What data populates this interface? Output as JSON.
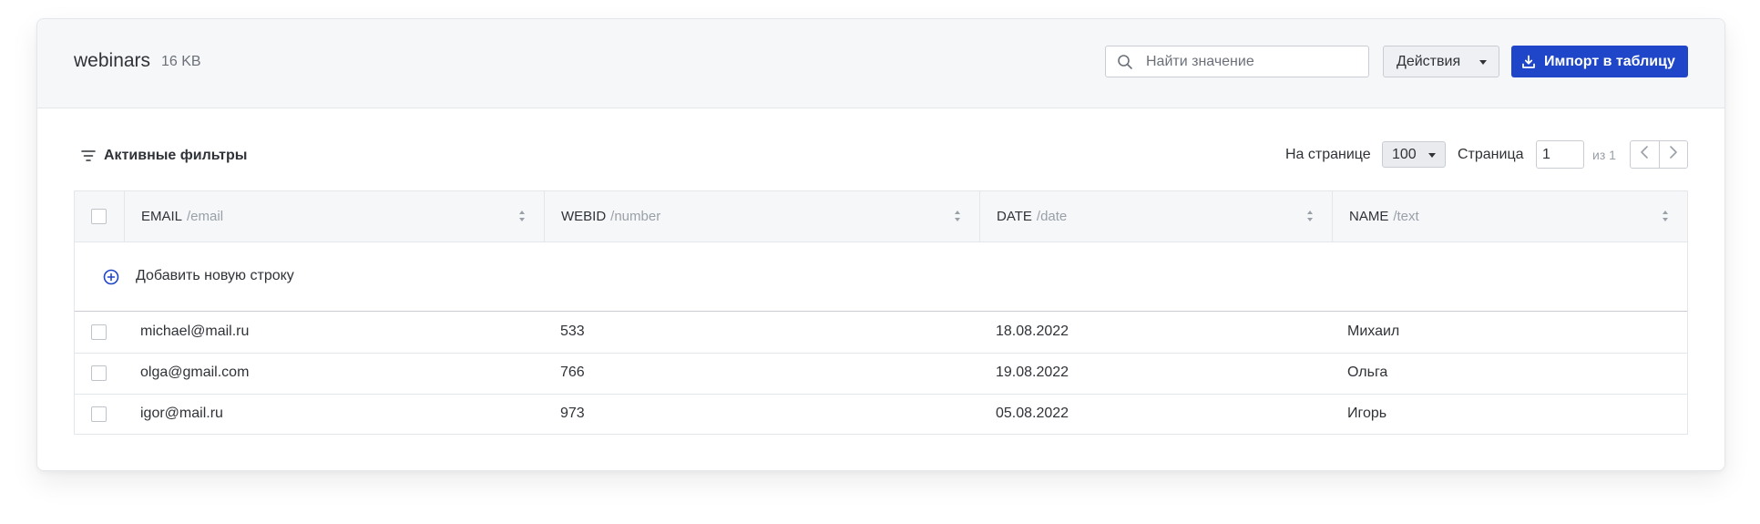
{
  "header": {
    "title": "webinars",
    "size": "16 KB",
    "search_placeholder": "Найти значение",
    "actions_label": "Действия",
    "import_label": "Импорт в таблицу"
  },
  "toolbar": {
    "filters_label": "Активные фильтры",
    "per_page_label": "На странице",
    "per_page_value": "100",
    "page_label": "Страница",
    "page_value": "1",
    "page_of": "из 1"
  },
  "table": {
    "columns": [
      {
        "name": "EMAIL",
        "type": "/email"
      },
      {
        "name": "WEBID",
        "type": "/number"
      },
      {
        "name": "DATE",
        "type": "/date"
      },
      {
        "name": "NAME",
        "type": "/text"
      }
    ],
    "add_row_label": "Добавить новую строку",
    "rows": [
      [
        "michael@mail.ru",
        "533",
        "18.08.2022",
        "Михаил"
      ],
      [
        "olga@gmail.com",
        "766",
        "19.08.2022",
        "Ольга"
      ],
      [
        "igor@mail.ru",
        "973",
        "05.08.2022",
        "Игорь"
      ]
    ]
  },
  "colors": {
    "accent": "#1f46c8",
    "header_bg": "#f6f7f9",
    "border": "#e3e6ea"
  },
  "icons": {
    "search": "search-icon",
    "caret": "caret-down-icon",
    "import": "download-icon",
    "filter": "filter-icon",
    "sort": "sort-icon",
    "add": "plus-circle-icon",
    "prev": "chevron-left-icon",
    "next": "chevron-right-icon"
  }
}
